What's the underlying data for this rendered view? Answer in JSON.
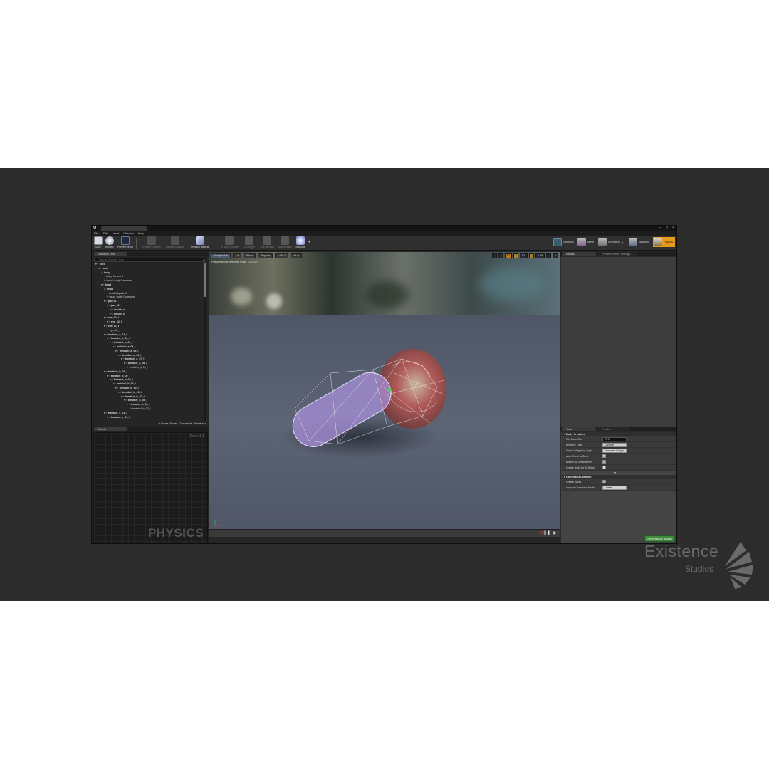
{
  "window": {
    "doc_tab": "",
    "menu": [
      "File",
      "Edit",
      "Asset",
      "Window",
      "Help"
    ]
  },
  "toolbar": {
    "left_buttons": [
      {
        "label": "Save",
        "icon": "save-icon",
        "enabled": true
      },
      {
        "label": "Browse",
        "icon": "browse-icon",
        "enabled": true
      },
      {
        "label": "Preview Mesh",
        "icon": "preview-mesh-icon",
        "enabled": true
      }
    ],
    "mid_buttons": [
      {
        "label": "Enable Collision",
        "icon": "collision-enable-icon",
        "enabled": false
      },
      {
        "label": "Disable Collision",
        "icon": "collision-disable-icon",
        "enabled": false
      },
      {
        "label": "Physical Material",
        "icon": "physical-material-icon",
        "enabled": true
      }
    ],
    "right_buttons": [
      {
        "label": "To Add a Socket",
        "icon": "wrench-icon",
        "enabled": false
      },
      {
        "label": "To Weight",
        "icon": "weight-icon",
        "enabled": false
      },
      {
        "label": "To Kinematic",
        "icon": "kinematic-icon",
        "enabled": false
      },
      {
        "label": "To Animated",
        "icon": "animated-icon",
        "enabled": false
      },
      {
        "label": "Simulate",
        "icon": "simulate-icon",
        "enabled": true
      }
    ],
    "modes": [
      {
        "label": "Skeleton",
        "icon": "skeleton-mode-icon"
      },
      {
        "label": "Mesh",
        "icon": "mesh-mode-icon"
      },
      {
        "label": "Animation",
        "icon": "animation-mode-icon"
      },
      {
        "label": "Blueprint",
        "icon": "blueprint-mode-icon"
      },
      {
        "label": "Physics",
        "icon": "physics-mode-icon"
      }
    ],
    "accent": "#e69a1e"
  },
  "skeleton_tree": {
    "tab": "Skeleton Tree",
    "search_placeholder": "Search Skeleton Tree...",
    "footer": "Bones, Bodies, Constraints, Primitives",
    "nodes": [
      {
        "t": "root",
        "d": 0,
        "k": "bone"
      },
      {
        "t": "body",
        "d": 1,
        "k": "bone"
      },
      {
        "t": "body",
        "d": 2,
        "k": "body"
      },
      {
        "t": "body Convex 0",
        "d": 3,
        "k": "shape"
      },
      {
        "t": "head : body Constraint",
        "d": 3,
        "k": "con"
      },
      {
        "t": "head",
        "d": 2,
        "k": "bone"
      },
      {
        "t": "head",
        "d": 3,
        "k": "body"
      },
      {
        "t": "head Capsule 0",
        "d": 4,
        "k": "shape"
      },
      {
        "t": "head : body Constraint",
        "d": 4,
        "k": "con"
      },
      {
        "t": "jaw_01",
        "d": 3,
        "k": "bone"
      },
      {
        "t": "jaw_02",
        "d": 4,
        "k": "bone"
      },
      {
        "t": "mouth_o",
        "d": 5,
        "k": "bone"
      },
      {
        "t": "mouth_ll",
        "d": 5,
        "k": "bone"
      },
      {
        "t": "eye_01_l",
        "d": 3,
        "k": "bone"
      },
      {
        "t": "eye_02_l",
        "d": 4,
        "k": "bone"
      },
      {
        "t": "eye_01_r",
        "d": 3,
        "k": "bone"
      },
      {
        "t": "eye_02_r",
        "d": 4,
        "k": "leaf"
      },
      {
        "t": "tentakel_a_01_l",
        "d": 3,
        "k": "bone"
      },
      {
        "t": "tentakel_a_02_l",
        "d": 4,
        "k": "bone"
      },
      {
        "t": "tentakel_a_03_l",
        "d": 5,
        "k": "bone"
      },
      {
        "t": "tentakel_a_04_l",
        "d": 6,
        "k": "bone"
      },
      {
        "t": "tentakel_a_05_l",
        "d": 7,
        "k": "bone"
      },
      {
        "t": "tentakel_a_06_l",
        "d": 8,
        "k": "bone"
      },
      {
        "t": "tentakel_a_07_l",
        "d": 9,
        "k": "bone"
      },
      {
        "t": "tentakel_a_08_l",
        "d": 10,
        "k": "bone"
      },
      {
        "t": "tentakel_a_09_l",
        "d": 11,
        "k": "leaf"
      },
      {
        "t": "tentakel_b_01_l",
        "d": 3,
        "k": "bone"
      },
      {
        "t": "tentakel_b_02_l",
        "d": 4,
        "k": "bone"
      },
      {
        "t": "tentakel_b_03_l",
        "d": 5,
        "k": "bone"
      },
      {
        "t": "tentakel_b_04_l",
        "d": 6,
        "k": "bone"
      },
      {
        "t": "tentakel_b_05_l",
        "d": 7,
        "k": "bone"
      },
      {
        "t": "tentakel_b_06_l",
        "d": 8,
        "k": "bone"
      },
      {
        "t": "tentakel_b_07_l",
        "d": 9,
        "k": "bone"
      },
      {
        "t": "tentakel_b_08_l",
        "d": 10,
        "k": "bone"
      },
      {
        "t": "tentakel_b_09_l",
        "d": 11,
        "k": "bone"
      },
      {
        "t": "tentakel_b_10_l",
        "d": 12,
        "k": "leaf"
      },
      {
        "t": "tentakel_c_01_l",
        "d": 3,
        "k": "bone"
      },
      {
        "t": "tentakel_c_02_l",
        "d": 4,
        "k": "bone"
      }
    ]
  },
  "graph": {
    "tab": "Graph",
    "zoom": "Zoom 1:1",
    "watermark": "PHYSICS"
  },
  "viewport": {
    "buttons": [
      "Perspective",
      "Lit",
      "Show",
      "Physics",
      "LOD 0",
      "x1.0"
    ],
    "right_tools": [
      "",
      "",
      "10",
      "",
      "10°",
      "",
      "0.25",
      "",
      "4"
    ],
    "overlay_title": "Previewing Reference Pose",
    "overlay_small": "Constraint"
  },
  "details": {
    "tabs": [
      "Details",
      "Preview Scene Settings"
    ]
  },
  "tools": {
    "tabs": [
      "Tools",
      "Profiles"
    ],
    "body_creation": {
      "header": "Body Creation",
      "rows": [
        {
          "label": "Min Bone Size",
          "type": "num",
          "value": "20.0"
        },
        {
          "label": "Primitive Type",
          "type": "select",
          "value": "Capsule"
        },
        {
          "label": "Vertex Weighting Type",
          "type": "select",
          "value": "Dominant Weight"
        },
        {
          "label": "Auto Orient to Bone",
          "type": "check",
          "checked": true
        },
        {
          "label": "Walk Past Small Bones",
          "type": "check",
          "checked": true
        },
        {
          "label": "Create Body for All Bones",
          "type": "check",
          "checked": false
        }
      ]
    },
    "constraint_creation": {
      "header": "Constraint Creation",
      "rows": [
        {
          "label": "Create Joints",
          "type": "check",
          "checked": true
        },
        {
          "label": "Angular Constraint Mode",
          "type": "select",
          "value": "Limited"
        }
      ]
    },
    "generate_button": "Generate All Bodies"
  },
  "watermark": {
    "brand": "Existence",
    "sub": "Studios"
  }
}
